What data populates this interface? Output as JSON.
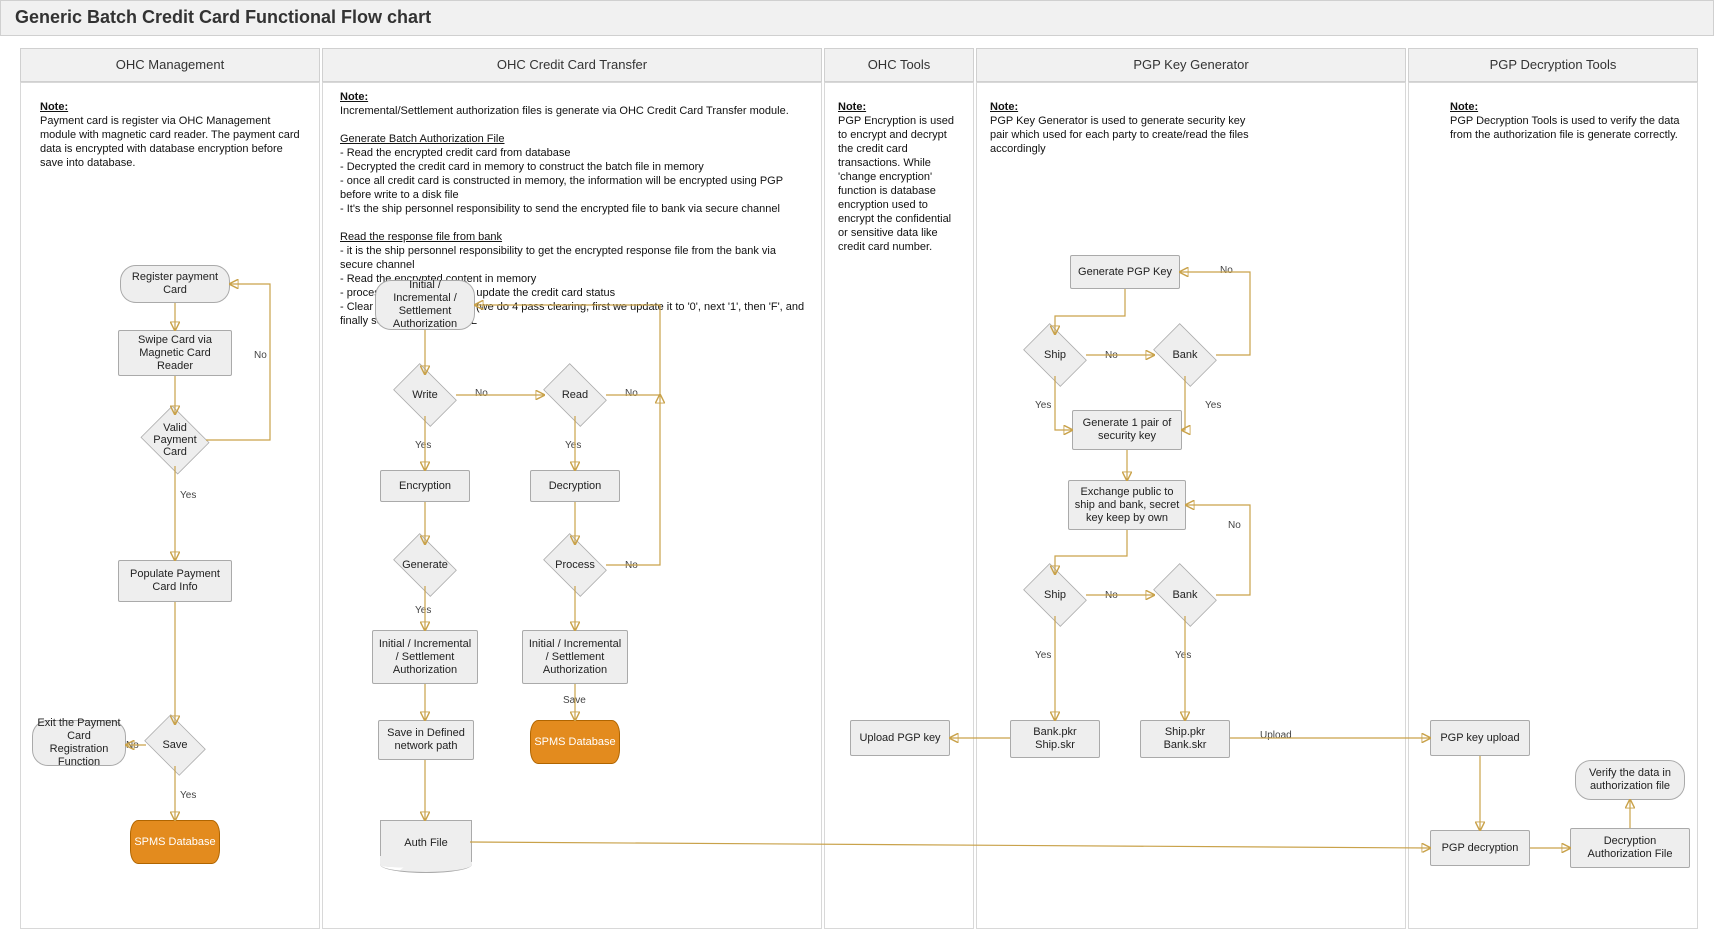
{
  "page": {
    "title": "Generic Batch Credit Card Functional Flow chart"
  },
  "lanes": {
    "l1": "OHC Management",
    "l2": "OHC Credit Card Transfer",
    "l3": "OHC Tools",
    "l4": "PGP Key Generator",
    "l5": "PGP Decryption Tools"
  },
  "notes": {
    "n1_hdr": "Note:",
    "n1_body": "Payment card is register via OHC Management module with magnetic card reader. The payment card data is encrypted with database encryption before save into database.",
    "n2_hdr": "Note:",
    "n2_intro": "Incremental/Settlement authorization files is generate via OHC Credit Card Transfer module.",
    "n2_sub1": "Generate Batch Authorization File",
    "n2_b1": "- Read the encrypted credit card from database",
    "n2_b2": "- Decrypted the credit card in memory to construct the batch file in memory",
    "n2_b3": "- once all credit card is constructed in memory, the information will be encrypted using PGP before write to a disk file",
    "n2_b4": "- It's the ship personnel responsibility to send the encrypted file to bank via secure channel",
    "n2_sub2": "Read the response file from bank",
    "n2_c1": "- it is the ship personnel responsibility to get the encrypted response file from the bank via secure channel",
    "n2_c2": "- Read the encrypted content in memory",
    "n2_c3": "- process the response and update the credit card status",
    "n2_c4": "- Clear the track 1 + track 2 (we do 4 pass clearing, first we update it to '0', next '1', then 'F', and finally set the value to NULL",
    "n3_hdr": "Note:",
    "n3_body": "PGP Encryption is used to encrypt and decrypt the credit card transactions. While 'change encryption' function is database encryption used to encrypt the confidential or sensitive data like credit card number.",
    "n4_hdr": "Note:",
    "n4_body": "PGP Key Generator is used to generate security key pair which used for each party to create/read the files accordingly",
    "n5_hdr": "Note:",
    "n5_body": "PGP Decryption Tools is used to verify the data from the authorization file is generate correctly."
  },
  "mgmt": {
    "s1": "Register payment Card",
    "s2": "Swipe Card via Magnetic Card Reader",
    "d1": "Valid Payment Card",
    "s3": "Populate Payment Card Info",
    "d2": "Save",
    "exit": "Exit the Payment Card Registration Function",
    "db": "SPMS Database"
  },
  "cct": {
    "init": "Initial / Incremental / Settlement Authorization",
    "write": "Write",
    "read": "Read",
    "enc": "Encryption",
    "dec": "Decryption",
    "gen": "Generate",
    "proc": "Process",
    "auth1": "Initial / Incremental / Settlement Authorization",
    "auth2": "Initial / Incremental / Settlement Authorization",
    "saveNet": "Save in Defined network path",
    "db": "SPMS Database",
    "authFile": "Auth File"
  },
  "tools": {
    "upload": "Upload PGP key"
  },
  "pgp": {
    "gen": "Generate PGP Key",
    "ship1": "Ship",
    "bank1": "Bank",
    "pair": "Generate 1 pair of security key",
    "exch": "Exchange public to ship and bank, secret key keep by own",
    "ship2": "Ship",
    "bank2": "Bank",
    "shipFiles": "Bank.pkr Ship.skr",
    "bankFiles": "Ship.pkr Bank.skr"
  },
  "dec": {
    "keyUp": "PGP key upload",
    "verify": "Verify the data in authorization file",
    "pgpDec": "PGP decryption",
    "decAuth": "Decryption Authorization File"
  },
  "labels": {
    "yes": "Yes",
    "no": "No",
    "save": "Save",
    "upload": "Upload"
  }
}
